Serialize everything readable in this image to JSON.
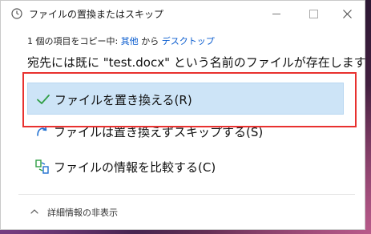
{
  "window": {
    "title": "ファイルの置換またはスキップ",
    "copy_prefix": "1 個の項目をコピー中: ",
    "copy_source": "其他",
    "copy_mid": " から ",
    "copy_dest": "デスクトップ"
  },
  "main": {
    "heading": "宛先には既に \"test.docx\" という名前のファイルが存在します"
  },
  "options": [
    {
      "label": "ファイルを置き換える(R)",
      "icon": "checkmark-icon"
    },
    {
      "label": "ファイルは置き換えずスキップする(S)",
      "icon": "skip-icon"
    },
    {
      "label": "ファイルの情報を比較する(C)",
      "icon": "compare-icon"
    }
  ],
  "footer": {
    "details_label": "詳細情報の非表示"
  },
  "colors": {
    "selected_bg": "#cde4f7",
    "link": "#0a5ccf",
    "highlight": "#e8312f",
    "check": "#2f9e44"
  }
}
